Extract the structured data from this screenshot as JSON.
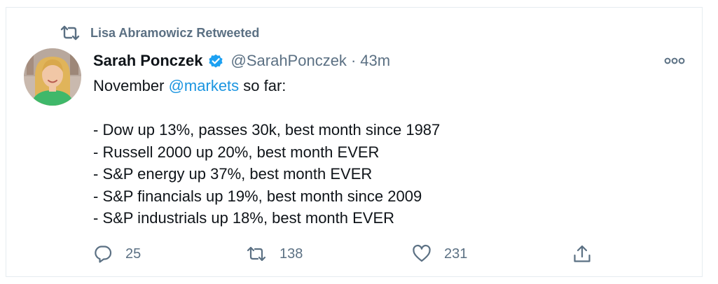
{
  "retweet": {
    "label": "Lisa Abramowicz Retweeted",
    "icon": "retweet-icon"
  },
  "tweet": {
    "author_name": "Sarah Ponczek",
    "verified": true,
    "handle": "@SarahPonczek",
    "separator": "·",
    "time": "43m",
    "text_prefix": "November ",
    "mention": "@markets",
    "text_suffix": " so far:",
    "bullets": [
      "- Dow up 13%, passes 30k, best month since 1987",
      "- Russell 2000 up 20%, best month EVER",
      "- S&P energy up 37%, best month EVER",
      "- S&P financials up 19%, best month since 2009",
      "- S&P industrials up 18%, best month EVER"
    ]
  },
  "actions": {
    "reply": {
      "icon": "reply-icon",
      "count": "25"
    },
    "retweet": {
      "icon": "retweet-icon",
      "count": "138"
    },
    "like": {
      "icon": "heart-icon",
      "count": "231"
    },
    "share": {
      "icon": "share-icon"
    }
  },
  "colors": {
    "text_primary": "#0f1419",
    "text_secondary": "#5b7083",
    "link": "#1b95e0",
    "verified": "#1da1f2",
    "border": "#e6ecf0"
  }
}
